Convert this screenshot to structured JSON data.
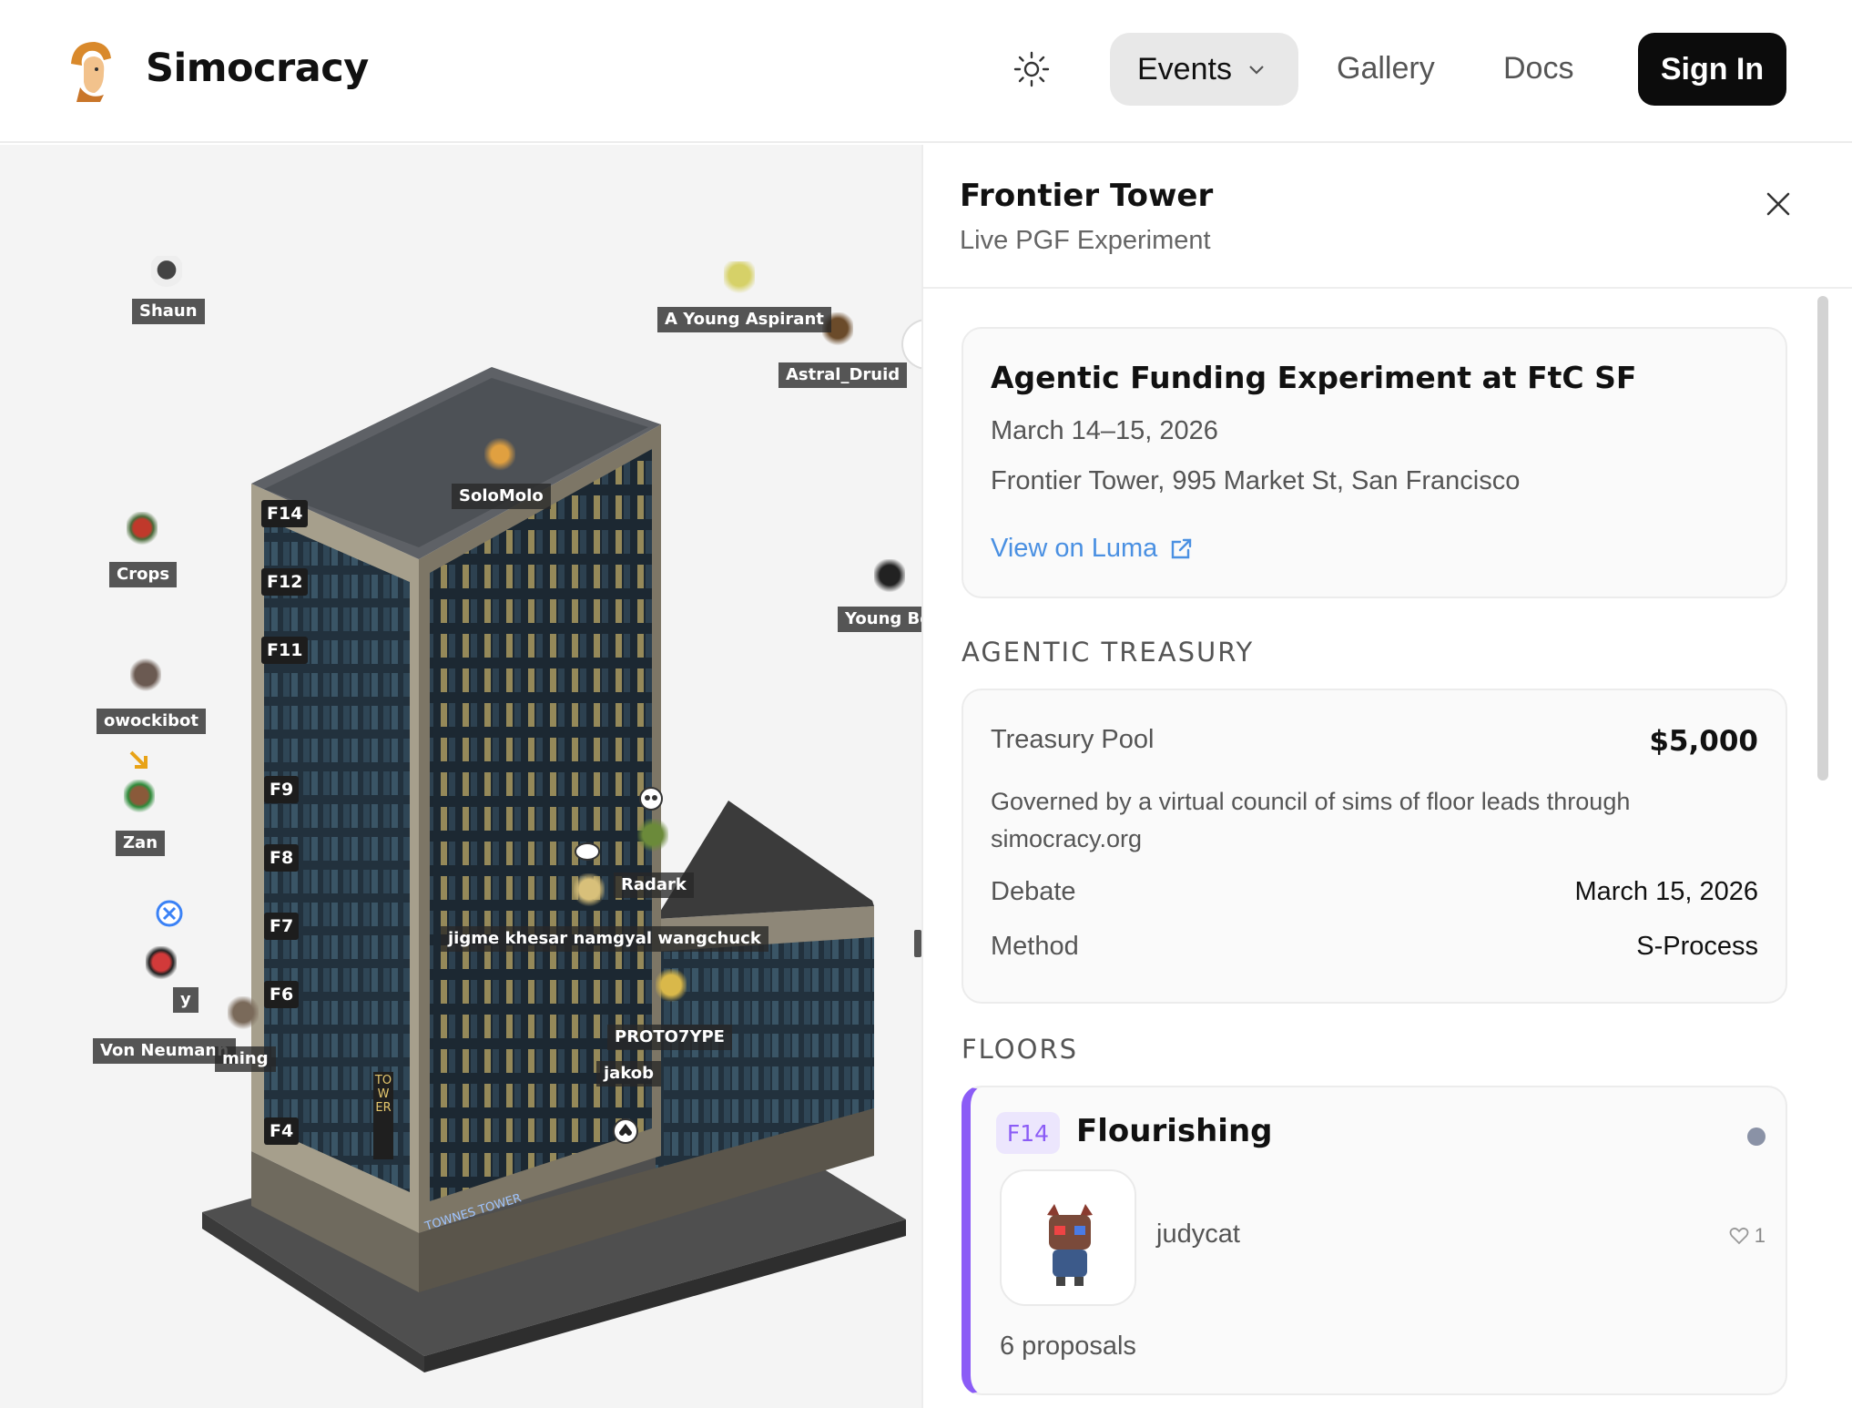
{
  "app": {
    "brand": "Simocracy",
    "logo_icon": "athena-helmet-icon"
  },
  "header": {
    "theme_icon": "sun-icon",
    "nav": {
      "events": "Events",
      "gallery": "Gallery",
      "docs": "Docs"
    },
    "signin": "Sign In"
  },
  "map": {
    "agents": [
      "Shaun",
      "A Young Aspirant",
      "Astral_Druid",
      "SoloMolo",
      "Crops",
      "Young Bo",
      "owockibot",
      "Zan",
      "Radark",
      "jigme khesar namgyal wangchuck",
      "PROTO7YPE",
      "jakob",
      "Von Neumann",
      "ming",
      "y"
    ],
    "floors": [
      "F14",
      "F12",
      "F11",
      "F9",
      "F8",
      "F7",
      "F6",
      "F4"
    ],
    "sign_tower": "TOWER",
    "sign_frontier": "TOWNES TOWER"
  },
  "panel": {
    "title": "Frontier Tower",
    "subtitle": "Live PGF Experiment",
    "event": {
      "title": "Agentic Funding Experiment at FtC SF",
      "dates": "March 14–15, 2026",
      "location": "Frontier Tower, 995 Market St, San Francisco",
      "link": "View on Luma"
    },
    "treasury_heading": "AGENTIC TREASURY",
    "treasury": {
      "pool_label": "Treasury Pool",
      "pool_value": "$5,000",
      "description": "Governed by a virtual council of sims of floor leads through simocracy.org",
      "debate_label": "Debate",
      "debate_value": "March 15, 2026",
      "method_label": "Method",
      "method_value": "S-Process"
    },
    "floors_heading": "FLOORS",
    "floor": {
      "badge": "F14",
      "name": "Flourishing",
      "accent": "#8b5cf6",
      "user": "judycat",
      "likes": "1",
      "proposals": "6 proposals"
    }
  }
}
